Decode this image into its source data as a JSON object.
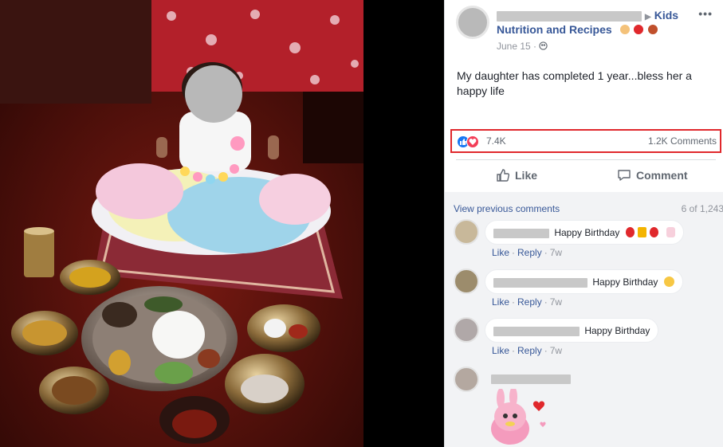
{
  "post": {
    "group_name_line1": "Kids",
    "group_name_line2": "Nutrition and Recipes",
    "date": "June 15",
    "text": "My daughter has completed 1 year...bless her a happy life"
  },
  "reactions": {
    "count": "7.4K",
    "comments": "1.2K Comments"
  },
  "actions": {
    "like": "Like",
    "comment": "Comment"
  },
  "comments_panel": {
    "view_previous": "View previous comments",
    "pager": "6 of 1,243",
    "items": [
      {
        "text": "Happy Birthday",
        "like": "Like",
        "reply": "Reply",
        "time": "7w"
      },
      {
        "text": "Happy Birthday",
        "like": "Like",
        "reply": "Reply",
        "time": "7w"
      },
      {
        "text": "Happy Birthday",
        "like": "Like",
        "reply": "Reply",
        "time": "7w"
      }
    ]
  },
  "icons": {
    "more": "more-options-icon",
    "like": "thumbs-up-icon",
    "comment": "speech-bubble-icon",
    "audience": "globe-icon"
  },
  "colors": {
    "link": "#385898",
    "like_blue": "#1877f2",
    "love_red": "#f33e58",
    "highlight_border": "#e0282c"
  }
}
